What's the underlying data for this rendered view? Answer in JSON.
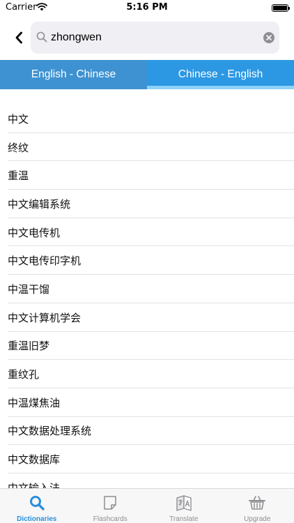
{
  "status_bar": {
    "carrier": "Carrier",
    "time": "5:16 PM"
  },
  "search": {
    "value": "zhongwen",
    "icon": "search-icon"
  },
  "tabs": [
    {
      "label": "English - Chinese",
      "active": false
    },
    {
      "label": "Chinese - English",
      "active": true
    }
  ],
  "results": [
    "中文",
    "终纹",
    "重温",
    "中文编辑系统",
    "中文电传机",
    "中文电传印字机",
    "中温干馏",
    "中文计算机学会",
    "重温旧梦",
    "重纹孔",
    "中温煤焦油",
    "中文数据处理系统",
    "中文数据库",
    "中文输入法"
  ],
  "tab_bar": [
    {
      "label": "Dictionaries",
      "icon": "search-icon",
      "selected": true
    },
    {
      "label": "Flashcards",
      "icon": "flashcard-icon",
      "selected": false
    },
    {
      "label": "Translate",
      "icon": "translate-icon",
      "selected": false
    },
    {
      "label": "Upgrade",
      "icon": "basket-icon",
      "selected": false
    }
  ],
  "colors": {
    "accent": "#2a8fdb",
    "tab_inactive": "#3e92d1",
    "tab_active": "#2c98e3",
    "tab_indicator": "#8ed2f7",
    "tab_bar_inactive": "#8e8e93"
  }
}
